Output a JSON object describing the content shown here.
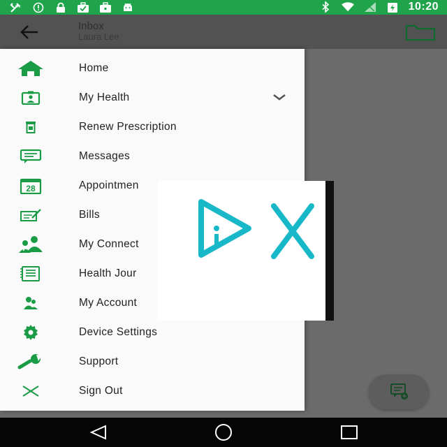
{
  "status_bar": {
    "time": "10:20",
    "left_icons": [
      "tools-icon",
      "alert-circle-icon",
      "lock-icon",
      "briefcase-check-icon",
      "bag-icon",
      "android-icon"
    ],
    "right_icons": [
      "bluetooth-icon",
      "wifi-icon",
      "signal-icon",
      "battery-charging-icon"
    ]
  },
  "toolbar": {
    "title": "Inbox",
    "subtitle": "Laura Lee"
  },
  "drawer": {
    "items": [
      {
        "label": "Home",
        "icon": "home-icon"
      },
      {
        "label": "My Health",
        "icon": "health-id-icon",
        "expandable": true
      },
      {
        "label": "Renew Prescription",
        "icon": "prescription-icon"
      },
      {
        "label": "Messages",
        "icon": "message-icon"
      },
      {
        "label": "Appointmen",
        "icon": "calendar-icon",
        "calendar_number": "28"
      },
      {
        "label": "Bills",
        "icon": "bill-icon"
      },
      {
        "label": "My Connect",
        "icon": "connections-icon"
      },
      {
        "label": "Health Jour",
        "icon": "journal-icon"
      },
      {
        "label": "My Account",
        "icon": "account-icon"
      },
      {
        "label": "Device Settings",
        "icon": "gear-icon"
      },
      {
        "label": "Support",
        "icon": "wrench-icon"
      },
      {
        "label": "Sign Out",
        "icon": "close-icon"
      }
    ]
  },
  "colors": {
    "accent": "#1fa44b",
    "overlay_accent": "#18b8c8"
  }
}
